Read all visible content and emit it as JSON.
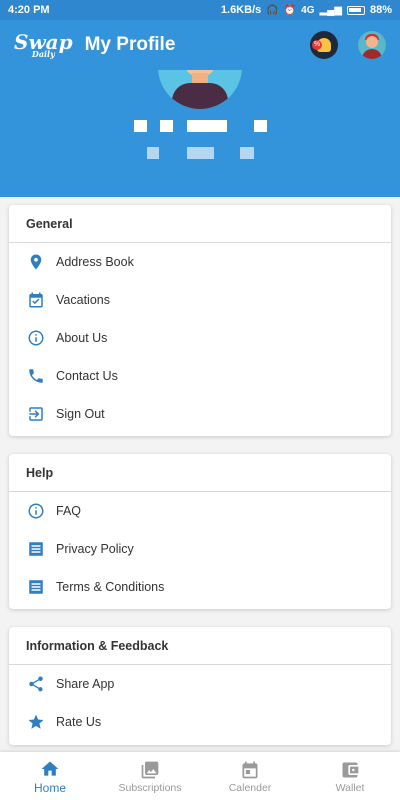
{
  "status_bar": {
    "time": "4:20 PM",
    "network_speed": "1.6KB/s",
    "network_type": "4G",
    "battery": "88%"
  },
  "app_bar": {
    "logo_top": "Swap",
    "logo_bottom": "Daily",
    "title": "My Profile",
    "icons": [
      "offer-bell-icon",
      "profile-avatar-icon"
    ]
  },
  "sections": [
    {
      "title": "General",
      "items": [
        {
          "label": "Address Book",
          "icon": "location-pin-icon"
        },
        {
          "label": "Vacations",
          "icon": "calendar-check-icon"
        },
        {
          "label": "About Us",
          "icon": "info-icon"
        },
        {
          "label": "Contact Us",
          "icon": "phone-icon"
        },
        {
          "label": "Sign Out",
          "icon": "sign-out-icon"
        }
      ]
    },
    {
      "title": "Help",
      "items": [
        {
          "label": "FAQ",
          "icon": "info-icon"
        },
        {
          "label": "Privacy Policy",
          "icon": "document-icon"
        },
        {
          "label": "Terms & Conditions",
          "icon": "document-icon"
        }
      ]
    },
    {
      "title": "Information & Feedback",
      "items": [
        {
          "label": "Share App",
          "icon": "share-icon"
        },
        {
          "label": "Rate Us",
          "icon": "star-icon"
        }
      ]
    }
  ],
  "bottom_nav": [
    {
      "label": "Home",
      "icon": "home-icon",
      "active": true
    },
    {
      "label": "Subscriptions",
      "icon": "image-icon",
      "active": false
    },
    {
      "label": "Calender",
      "icon": "calendar-icon",
      "active": false
    },
    {
      "label": "Wallet",
      "icon": "wallet-icon",
      "active": false
    }
  ],
  "colors": {
    "primary": "#3394dc",
    "icon": "#2f7fc0",
    "nav_active": "#2f7fc0",
    "nav_inactive": "#9a9a9a"
  }
}
